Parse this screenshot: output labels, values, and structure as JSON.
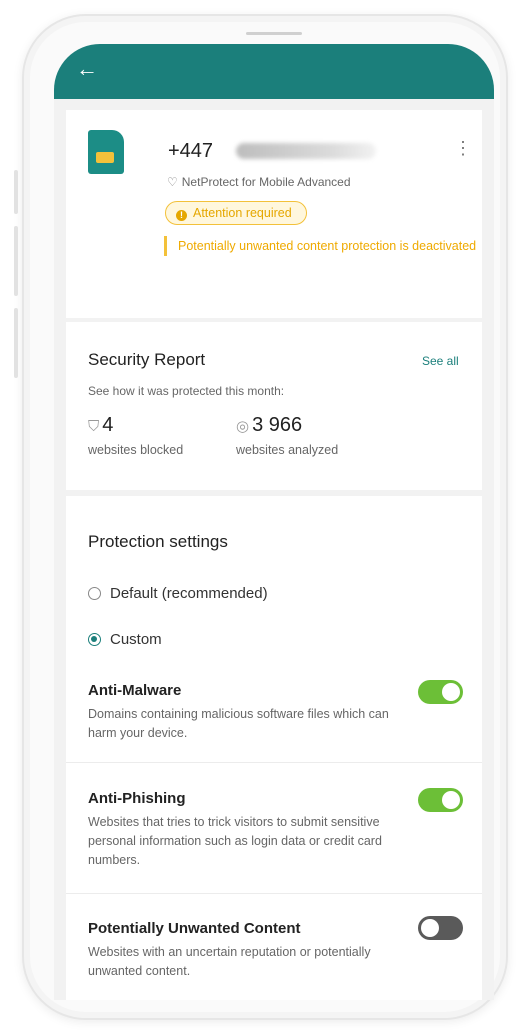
{
  "app": {
    "back_icon": "←"
  },
  "device": {
    "phone_number": "+447",
    "product_name": "NetProtect for Mobile Advanced",
    "attention_badge": "Attention required",
    "alert_message": "Potentially unwanted content protection is deactivated",
    "more_icon": "⋮"
  },
  "security_report": {
    "title": "Security Report",
    "see_all": "See all",
    "subtitle": "See how it was protected this month:",
    "blocked_value": "4",
    "blocked_label": "websites blocked",
    "analyzed_value": "3 966",
    "analyzed_label": "websites analyzed"
  },
  "protection": {
    "title": "Protection settings",
    "options": [
      {
        "label": "Default (recommended)",
        "selected": false
      },
      {
        "label": "Custom",
        "selected": true
      }
    ],
    "features": [
      {
        "name": "Anti-Malware",
        "description": "Domains containing malicious software files which can harm your device.",
        "enabled": true
      },
      {
        "name": "Anti-Phishing",
        "description": "Websites that tries to trick visitors to submit sensitive personal information such as login data or credit card numbers.",
        "enabled": true
      },
      {
        "name": "Potentially Unwanted Content",
        "description": "Websites with an uncertain reputation or potentially unwanted content.",
        "enabled": false
      }
    ]
  },
  "colors": {
    "brand": "#1b7f7b",
    "warning": "#f3c13a",
    "toggle_on": "#6cbf37",
    "toggle_off": "#5a5a5a"
  }
}
